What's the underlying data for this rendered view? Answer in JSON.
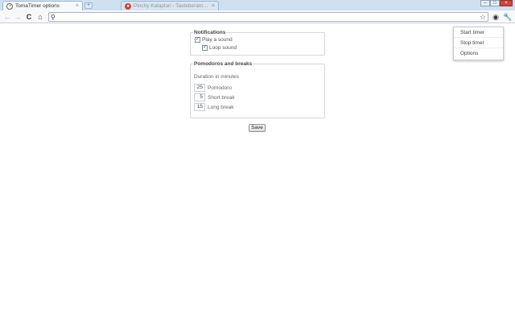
{
  "tabs": [
    {
      "label": "TomaTimer options",
      "close": "×"
    },
    {
      "label": "Pinchy Kalaplan - Tasteberamde C...",
      "close": "×"
    }
  ],
  "newtab": "+",
  "window_controls": {
    "minimize": "–",
    "maximize": "□",
    "close": "×"
  },
  "toolbar": {
    "back": "←",
    "forward": "→",
    "reload": "C",
    "home": "⌂",
    "search_glyph": "⚲",
    "url_value": "",
    "star": "☆",
    "ext_icon": "◉",
    "wrench": "🔧"
  },
  "popup_menu": {
    "items": [
      "Start timer",
      "Stop timer",
      "Options"
    ]
  },
  "notifications": {
    "legend": "Notifications",
    "check_glyph": "✓",
    "play_sound": {
      "label": "Play a sound",
      "checked": true
    },
    "loop_sound": {
      "label": "Loop sound",
      "checked": true
    }
  },
  "pomodoros": {
    "legend": "Pomodoros and breaks",
    "duration_label": "Duration in minutes",
    "rows": [
      {
        "value": "25",
        "label": "Pomodoro"
      },
      {
        "value": "5",
        "label": "Short break"
      },
      {
        "value": "15",
        "label": "Long break"
      }
    ]
  },
  "save_label": "Save"
}
